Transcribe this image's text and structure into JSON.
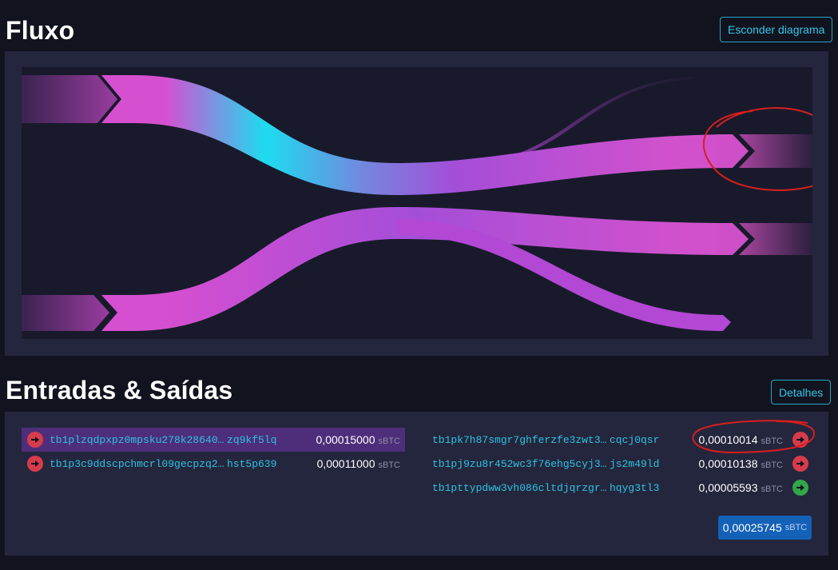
{
  "flow_section": {
    "title": "Fluxo",
    "hide_button_label": "Esconder diagrama"
  },
  "io_section": {
    "title": "Entradas & Saídas",
    "details_button_label": "Detalhes",
    "unit": "sBTC",
    "inputs": [
      {
        "address_head": "tb1plzqdpxpz0mpsku278k28640…",
        "address_tail": "zq9kf5lq",
        "amount": "0,00015000",
        "arrow": "red",
        "highlighted": true
      },
      {
        "address_head": "tb1p3c9ddscpchmcrl09gecpzq2…",
        "address_tail": "hst5p639",
        "amount": "0,00011000",
        "arrow": "red",
        "highlighted": false
      }
    ],
    "outputs": [
      {
        "address_head": "tb1pk7h87smgr7ghferzfe3zwt3…",
        "address_tail": "cqcj0qsr",
        "amount": "0,00010014",
        "arrow": "red"
      },
      {
        "address_head": "tb1pj9zu8r452wc3f76ehg5cyj3…",
        "address_tail": "js2m49ld",
        "amount": "0,00010138",
        "arrow": "red"
      },
      {
        "address_head": "tb1pttypdww3vh086cltdjqrzgr…",
        "address_tail": "hqyg3tl3",
        "amount": "0,00005593",
        "arrow": "green"
      }
    ],
    "total": "0,00025745"
  },
  "colors": {
    "accent_cyan": "#2cc3e3",
    "flow_magenta": "#d54ed0",
    "flow_purple": "#a24fd6",
    "spent_red": "#d83b4b",
    "unspent_green": "#31a64a",
    "total_blue": "#1461b8",
    "annotation_red": "#d61f1f"
  },
  "icons": {
    "arrow": "arrow-right-icon"
  }
}
